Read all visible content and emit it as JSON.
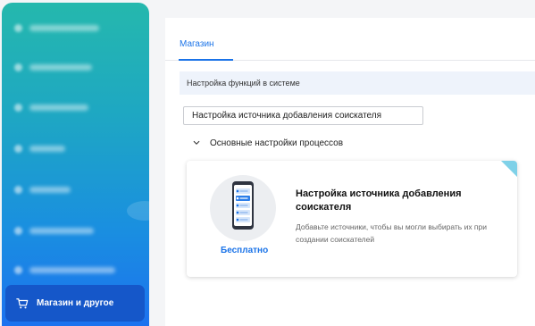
{
  "sidebar": {
    "items": [
      {
        "icon": "blurred-icon",
        "label": ""
      },
      {
        "icon": "blurred-icon",
        "label": ""
      },
      {
        "icon": "blurred-icon",
        "label": ""
      },
      {
        "icon": "blurred-icon",
        "label": ""
      },
      {
        "icon": "blurred-icon",
        "label": ""
      },
      {
        "icon": "blurred-icon",
        "label": ""
      },
      {
        "icon": "blurred-icon",
        "label": ""
      }
    ],
    "active_item": {
      "icon": "cart-icon",
      "label": "Магазин и другое"
    }
  },
  "main": {
    "tabs": [
      {
        "label": "Магазин",
        "active": true
      }
    ],
    "section_title": "Настройка функций в системе",
    "search": {
      "value": "Настройка источника добавления соискателя"
    },
    "group": {
      "label": "Основные настройки процессов",
      "expanded": true
    },
    "card": {
      "title": "Настройка источника добавления соискателя",
      "description": "Добавьте источники, чтобы вы могли выбирать их при создании соискателей",
      "price_label": "Бесплатно",
      "icon": "smartphone-icon"
    }
  },
  "colors": {
    "accent": "#1a73e8",
    "sidebar_active": "#1557c9",
    "sidebar_top": "#25b8ad",
    "sidebar_bottom": "#1c72ef"
  }
}
